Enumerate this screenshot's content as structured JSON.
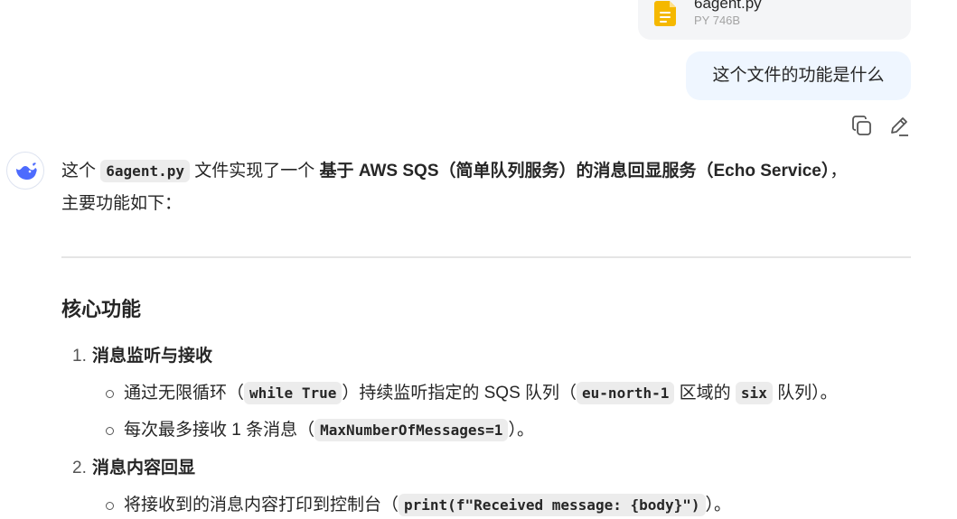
{
  "attachment": {
    "name": "6agent.py",
    "meta": "PY 746B",
    "icon": "file-doc-icon",
    "color": "#f5b800"
  },
  "user_message": {
    "text": "这个文件的功能是什么",
    "actions": [
      "copy-icon",
      "edit-icon"
    ]
  },
  "assistant": {
    "avatar_icon": "whale-logo-icon",
    "avatar_color": "#4d6bfe",
    "intro": {
      "t1": "这个 ",
      "code1": "6agent.py",
      "t2": " 文件实现了一个 ",
      "bold": "基于 AWS SQS（简单队列服务）的消息回显服务（Echo Service）",
      "t3": "，",
      "line2": "主要功能如下："
    },
    "section_heading": "核心功能",
    "items": [
      {
        "num": "1.",
        "title": "消息监听与接收",
        "bullets": [
          {
            "a": "通过无限循环（",
            "code1": "while True",
            "b": "）持续监听指定的 SQS 队列（",
            "code2": "eu-north-1",
            "c": " 区域的 ",
            "code3": "six",
            "d": " 队列）。"
          },
          {
            "a": "每次最多接收 1 条消息（",
            "code1": "MaxNumberOfMessages=1",
            "b": "）。"
          }
        ]
      },
      {
        "num": "2.",
        "title": "消息内容回显",
        "bullets": [
          {
            "a": "将接收到的消息内容打印到控制台（",
            "code1": "print(f\"Received message: {body}\")",
            "b": "）。"
          }
        ]
      }
    ]
  }
}
